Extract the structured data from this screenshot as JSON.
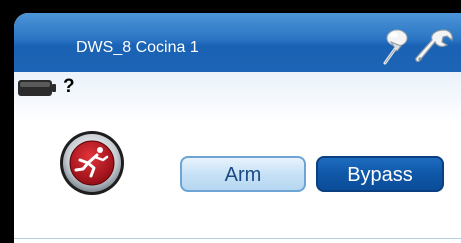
{
  "window": {
    "title": "DWS_8 Cocina 1"
  },
  "header_icons": {
    "pin": "pin-icon",
    "settings": "wrench-icon"
  },
  "battery": {
    "icon": "battery-icon",
    "status_text": "?"
  },
  "zone_status": {
    "icon": "running-person-alarm-icon",
    "color": "#c0121c"
  },
  "actions": {
    "arm_label": "Arm",
    "bypass_label": "Bypass"
  },
  "colors": {
    "titlebar": "#2a74c4",
    "bypass_button": "#0f57a8",
    "arm_button": "#c7e1f6"
  }
}
